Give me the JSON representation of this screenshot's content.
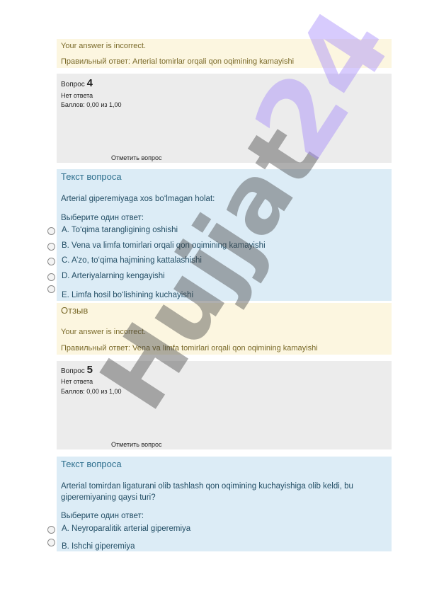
{
  "feedback1": {
    "incorrect": "Your answer is incorrect.",
    "correct_answer": "Правильный ответ: Arterial tomirlar orqali qon oqimining kamayishi"
  },
  "question4": {
    "label": "Вопрос",
    "number": "4",
    "status": "Нет ответа",
    "grade": "Баллов: 0,00 из 1,00",
    "flag": "Отметить вопрос",
    "section_title": "Текст вопроса",
    "text": "Arterial giperemiyaga xos bo‘lmagan holat:",
    "prompt": "Выберите один ответ:",
    "options": [
      "A. To‘qima tarangligining oshishi",
      "B. Vena va limfa tomirlari orqali qon oqimining kamayishi",
      "C. A’zo, to‘qima hajmining kattalashishi",
      "D. Arteriyalarning kengayishi",
      "E. Limfa hosil bo‘lishining kuchayishi"
    ]
  },
  "feedback2": {
    "title": "Отзыв",
    "incorrect": "Your answer is incorrect.",
    "correct_answer": "Правильный ответ: Vena va limfa tomirlari orqali qon oqimining kamayishi"
  },
  "question5": {
    "label": "Вопрос",
    "number": "5",
    "status": "Нет ответа",
    "grade": "Баллов: 0,00 из 1,00",
    "flag": "Отметить вопрос",
    "section_title": "Текст вопроса",
    "text": "Arterial tomirdan ligaturani olib tashlash qon oqimining kuchayishiga olib keldi, bu giperemiyaning qaysi turi?",
    "prompt": "Выберите один ответ:",
    "options": [
      "A. Neyroparalitik arterial giperemiya",
      "B. Ishchi giperemiya"
    ]
  },
  "watermark": {
    "text": "Hujjat 24",
    "colors": {
      "hujjat": "#404040",
      "num": "#a78bfa"
    }
  }
}
